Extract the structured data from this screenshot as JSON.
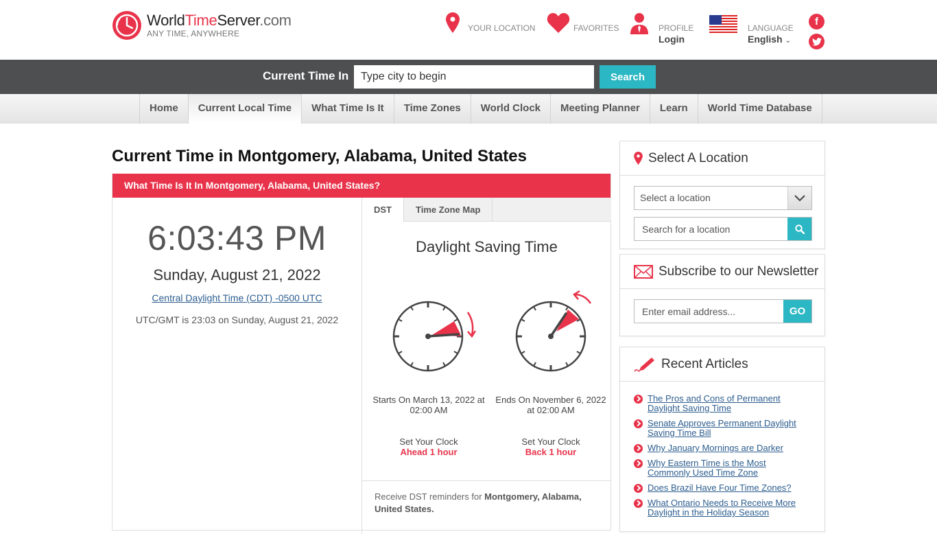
{
  "brand": {
    "name_part1": "World",
    "name_part2": "Time",
    "name_part3": "Server",
    "name_tld": ".com",
    "tagline": "ANY TIME, ANYWHERE",
    "accent_color": "#e8334a",
    "teal_color": "#2bb7c3"
  },
  "header_nav": {
    "location_label": "YOUR LOCATION",
    "favorites_label": "FAVORITES",
    "profile_label": "PROFILE",
    "profile_value": "Login",
    "language_label": "LANGUAGE",
    "language_value": "English",
    "facebook_glyph": "f",
    "twitter_glyph": "t"
  },
  "searchbar": {
    "label": "Current Time In",
    "placeholder": "Type city to begin",
    "button": "Search"
  },
  "main_nav": [
    {
      "label": "Home",
      "active": false
    },
    {
      "label": "Current Local Time",
      "active": true
    },
    {
      "label": "What Time Is It",
      "active": false
    },
    {
      "label": "Time Zones",
      "active": false
    },
    {
      "label": "World Clock",
      "active": false
    },
    {
      "label": "Meeting Planner",
      "active": false
    },
    {
      "label": "Learn",
      "active": false
    },
    {
      "label": "World Time Database",
      "active": false
    }
  ],
  "page": {
    "title": "Current Time in Montgomery, Alabama, United States",
    "panel_heading": "What Time Is It In Montgomery, Alabama, United States?",
    "time": "6:03:43 PM",
    "date": "Sunday, August 21, 2022",
    "timezone_link": "Central Daylight Time (CDT) -0500 UTC",
    "utc_line": "UTC/GMT is 23:03 on Sunday, August 21, 2022"
  },
  "dst": {
    "tabs": [
      {
        "label": "DST",
        "active": true
      },
      {
        "label": "Time Zone Map",
        "active": false
      }
    ],
    "title": "Daylight Saving Time",
    "start_caption": "Starts On March 13, 2022 at 02:00 AM",
    "end_caption": "Ends On November 6, 2022 at 02:00 AM",
    "set_clock_label": "Set Your Clock",
    "start_action": "Ahead 1 hour",
    "end_action": "Back 1 hour",
    "reminder_prefix": "Receive DST reminders for ",
    "reminder_location": "Montgomery, Alabama, United States."
  },
  "sidebar": {
    "select_location": {
      "title": "Select A Location",
      "select_value": "Select a location",
      "search_placeholder": "Search for a location"
    },
    "newsletter": {
      "title": "Subscribe to our Newsletter",
      "email_placeholder": "Enter email address...",
      "button": "GO"
    },
    "recent_articles": {
      "title": "Recent Articles",
      "items": [
        "The Pros and Cons of Permanent Daylight Saving Time",
        "Senate Approves Permanent Daylight Saving Time Bill",
        "Why January Mornings are Darker",
        "Why Eastern Time is the Most Commonly Used Time Zone",
        "Does Brazil Have Four Time Zones?",
        "What Ontario Needs to Receive More Daylight in the Holiday Season"
      ]
    }
  }
}
